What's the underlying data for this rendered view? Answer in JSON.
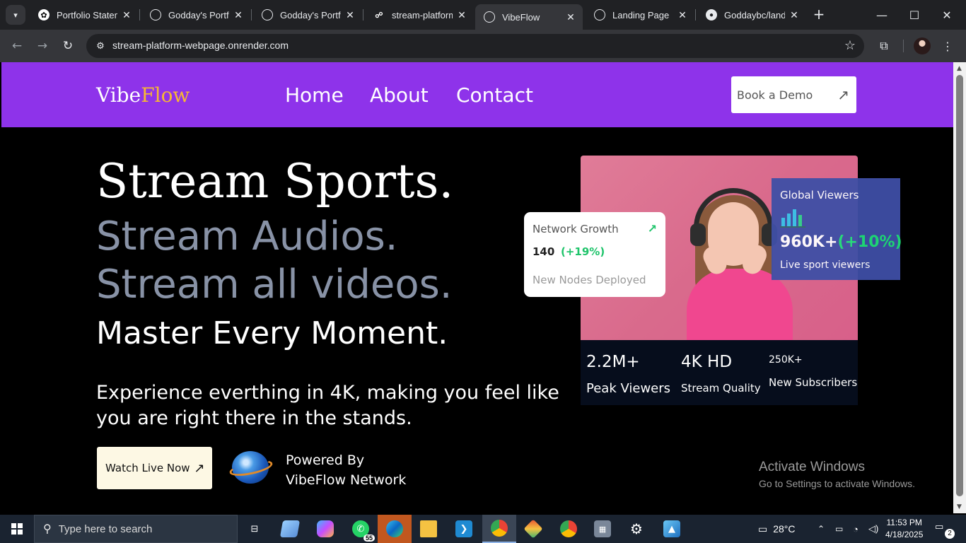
{
  "browser": {
    "tabs": [
      {
        "title": "Portfolio Statem",
        "icon": "openai-icon",
        "active": false
      },
      {
        "title": "Godday's Portfo",
        "icon": "globe-icon",
        "active": false
      },
      {
        "title": "Godday's Portfo",
        "icon": "globe-icon",
        "active": false
      },
      {
        "title": "stream-platform",
        "icon": "render-icon",
        "active": false
      },
      {
        "title": "VibeFlow",
        "icon": "globe-icon",
        "active": true
      },
      {
        "title": "Landing Page",
        "icon": "globe-icon",
        "active": false
      },
      {
        "title": "Goddaybc/landi",
        "icon": "github-icon",
        "active": false
      }
    ],
    "url": "stream-platform-webpage.onrender.com"
  },
  "page": {
    "logo": {
      "part1": "Vibe",
      "part2": "Flow"
    },
    "nav": {
      "home": "Home",
      "about": "About",
      "contact": "Contact"
    },
    "demo_button": "Book a Demo",
    "headline": "Stream Sports.",
    "subline1": "Stream Audios.",
    "subline2": "Stream all videos.",
    "master": "Master Every Moment.",
    "tagline": "Experience everthing in 4K, making you feel like you are right there in the stands.",
    "watch_button": "Watch Live Now",
    "powered": {
      "line1": "Powered By",
      "line2": "VibeFlow Network"
    },
    "growth_card": {
      "title": "Network Growth",
      "value": "140",
      "change": "(+19%)",
      "subtitle": "New Nodes Deployed"
    },
    "viewers_card": {
      "title": "Global Viewers",
      "value": "960K+",
      "change": "(+10%)",
      "subtitle": "Live sport viewers"
    },
    "stats": [
      {
        "value": "2.2M+",
        "label": "Peak Viewers"
      },
      {
        "value": "4K HD",
        "label": "Stream Quality"
      },
      {
        "value": "250K+",
        "label": "New Subscribers"
      }
    ],
    "activate": {
      "line1": "Activate Windows",
      "line2": "Go to Settings to activate Windows."
    }
  },
  "taskbar": {
    "search_placeholder": "Type here to search",
    "whatsapp_badge": "55",
    "weather": "28°C",
    "time": "11:53 PM",
    "date": "4/18/2025",
    "notifications": "2"
  },
  "colors": {
    "nav_bg": "#8e33ea",
    "logo_accent": "#f7b733",
    "positive": "#1fc46b"
  }
}
